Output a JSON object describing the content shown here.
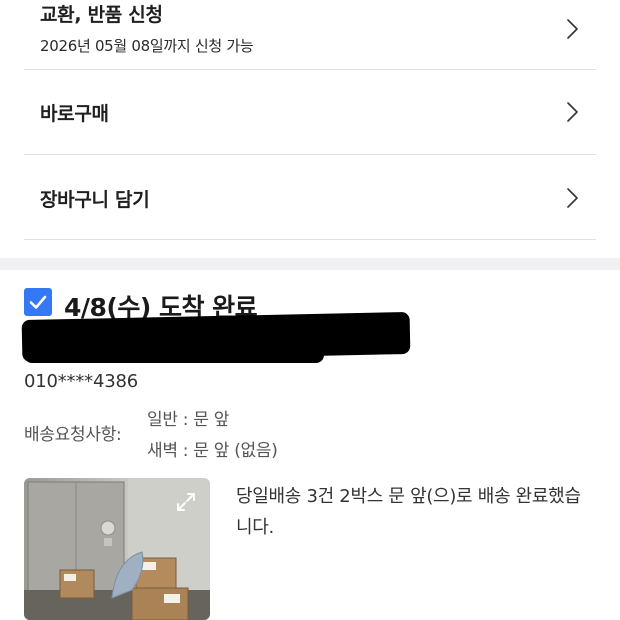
{
  "menu": {
    "exchange_return": {
      "title": "교환, 반품 신청",
      "subtitle": "2026년 05월 08일까지 신청 가능"
    },
    "buy_now": {
      "title": "바로구매"
    },
    "add_to_cart": {
      "title": "장바구니 담기"
    }
  },
  "delivery": {
    "status_title": "4/8(수) 도착 완료",
    "phone": "010****4386",
    "request_label": "배송요청사항:",
    "request_general": "일반 : 문 앞",
    "request_dawn": "새벽 : 문 앞 (없음)",
    "message": "당일배송 3건 2박스 문 앞(으)로 배송 완료했습니다."
  },
  "icons": {
    "chevron": "chevron-right-icon",
    "checkbox": "checkbox-checked-icon",
    "expand": "expand-icon"
  },
  "colors": {
    "accent": "#3478f6",
    "divider": "#e1e1e1",
    "band": "#f1f1f3"
  }
}
